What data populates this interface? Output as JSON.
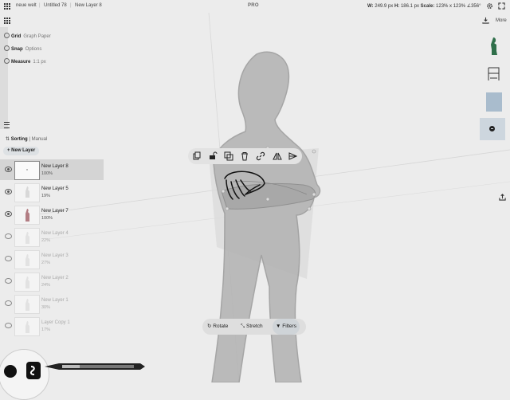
{
  "topbar": {
    "breadcrumbs": [
      "neue welt",
      "Untitled 78",
      "New Layer 8"
    ],
    "separator": "|",
    "pro_label": "PRO",
    "metrics": {
      "w_label": "W:",
      "w_value": "249.9 px",
      "h_label": "H:",
      "h_value": "186.1 px",
      "scale_label": "Scale:",
      "scale_value": "123% x 123% ∠356°"
    },
    "icons": [
      "grid-icon",
      "gear-icon",
      "fullscreen-icon"
    ]
  },
  "tools": {
    "grid": {
      "label": "Grid",
      "value": "Graph Paper"
    },
    "snap": {
      "label": "Snap",
      "value": "Options"
    },
    "measure": {
      "label": "Measure",
      "value": "1:1 px"
    }
  },
  "layers_panel": {
    "sorting_label": "Sorting",
    "sorting_sep": "|",
    "sorting_value": "Manual",
    "new_layer_label": "+ New Layer",
    "layers": [
      {
        "name": "New Layer 8",
        "opacity": "100%",
        "visible": true,
        "active": true,
        "dim": false
      },
      {
        "name": "New Layer 5",
        "opacity": "19%",
        "visible": true,
        "active": false,
        "dim": false
      },
      {
        "name": "New Layer 7",
        "opacity": "100%",
        "visible": true,
        "active": false,
        "dim": false
      },
      {
        "name": "New Layer 4",
        "opacity": "22%",
        "visible": false,
        "active": false,
        "dim": true
      },
      {
        "name": "New Layer 3",
        "opacity": "27%",
        "visible": false,
        "active": false,
        "dim": true
      },
      {
        "name": "New Layer 2",
        "opacity": "24%",
        "visible": false,
        "active": false,
        "dim": true
      },
      {
        "name": "New Layer 1",
        "opacity": "30%",
        "visible": false,
        "active": false,
        "dim": true
      },
      {
        "name": "Layer Copy 1",
        "opacity": "17%",
        "visible": false,
        "active": false,
        "dim": true
      }
    ]
  },
  "right_panel": {
    "more_label": "More",
    "icons": [
      "download-icon",
      "share-icon",
      "add-icon"
    ]
  },
  "selection_toolbar": {
    "icons": [
      "copy-icon",
      "unlock-icon",
      "duplicate-icon",
      "trash-icon",
      "link-icon",
      "flip-horizontal-icon",
      "flip-vertical-icon"
    ]
  },
  "transform_bar": {
    "rotate_label": "Rotate",
    "stretch_label": "Stretch",
    "filters_label": "Filters"
  },
  "brush": {
    "icons": [
      "brush-icon",
      "color-swatch-icon"
    ]
  },
  "colors": {
    "background": "#ececec",
    "accent": "#cfd8e0",
    "active_layer": "#d4d4d4"
  }
}
